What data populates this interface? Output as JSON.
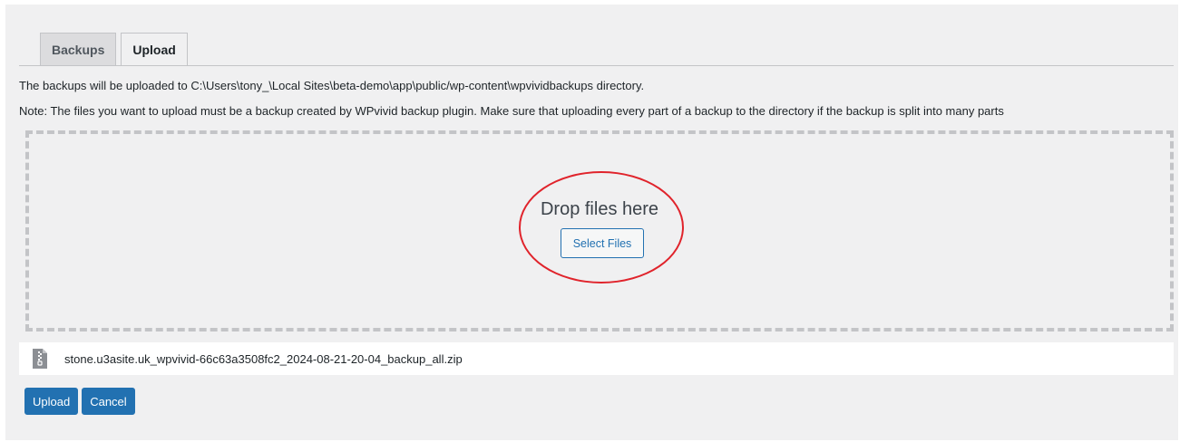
{
  "tabs": [
    {
      "label": "Backups",
      "active": false
    },
    {
      "label": "Upload",
      "active": true
    }
  ],
  "info": {
    "directory_text": "The backups will be uploaded to C:\\Users\\tony_\\Local Sites\\beta-demo\\app\\public/wp-content\\wpvividbackups directory.",
    "note_text": "Note: The files you want to upload must be a backup created by WPvivid backup plugin. Make sure that uploading every part of a backup to the directory if the backup is split into many parts"
  },
  "dropzone": {
    "title": "Drop files here",
    "select_label": "Select Files"
  },
  "file": {
    "icon": "zip-file-icon",
    "name": "stone.u3asite.uk_wpvivid-66c63a3508fc2_2024-08-21-20-04_backup_all.zip"
  },
  "actions": {
    "upload_label": "Upload",
    "cancel_label": "Cancel"
  },
  "colors": {
    "accent": "#2271b1",
    "annotation_ring": "#e0232b",
    "panel_bg": "#f0f0f1"
  }
}
